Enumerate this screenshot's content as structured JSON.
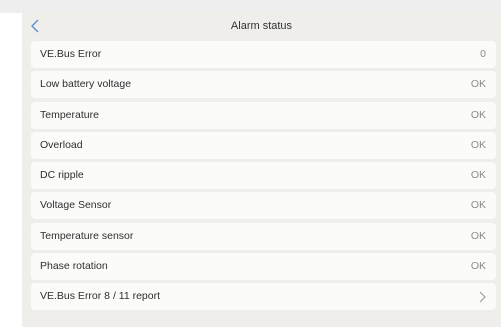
{
  "header": {
    "title": "Alarm status",
    "back_icon": "chevron-left-icon"
  },
  "colors": {
    "accent": "#5b8fd6",
    "panel_background": "#efeeeb",
    "row_background": "#fbfbfa",
    "label_text": "#2e2e2e",
    "value_text": "#8a8a8a"
  },
  "alarms": [
    {
      "label": "VE.Bus Error",
      "value": "0"
    },
    {
      "label": "Low battery voltage",
      "value": "OK"
    },
    {
      "label": "Temperature",
      "value": "OK"
    },
    {
      "label": "Overload",
      "value": "OK"
    },
    {
      "label": "DC ripple",
      "value": "OK"
    },
    {
      "label": "Voltage Sensor",
      "value": "OK"
    },
    {
      "label": "Temperature sensor",
      "value": "OK"
    },
    {
      "label": "Phase rotation",
      "value": "OK"
    }
  ],
  "report_link": {
    "label": "VE.Bus Error 8 / 11 report",
    "icon": "chevron-right-icon"
  }
}
